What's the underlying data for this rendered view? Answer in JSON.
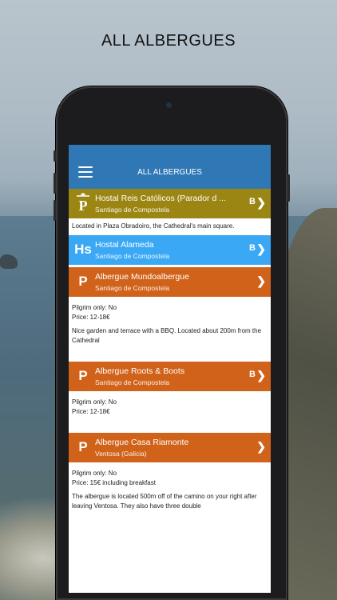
{
  "page_heading": "ALL ALBERGUES",
  "app": {
    "title": "ALL ALBERGUES",
    "menu_icon": "hamburger-menu-icon"
  },
  "items": [
    {
      "name": "Hostal Reis Católicos (Parador d ...",
      "city": "Santiago de Compostela",
      "logo": "P",
      "logo_icon": "parador-logo-icon",
      "badge": "B",
      "color": "#9c8613",
      "details": [
        "Located in Plaza Obradoiro, the Cathedral's main square."
      ]
    },
    {
      "name": "Hostal Alameda",
      "city": "Santiago de Compostela",
      "logo": "Hs",
      "badge": "B",
      "color": "#3aa8f5",
      "details": []
    },
    {
      "name": "Albergue Mundoalbergue",
      "city": "Santiago de Compostela",
      "logo": "P",
      "badge": "",
      "color": "#d0621a",
      "details": [
        "Pilgrim only: No",
        "Price: 12-18€",
        "Nice garden and terrace with a BBQ. Located about 200m from the Cathedral"
      ]
    },
    {
      "name": "Albergue Roots & Boots",
      "city": "Santiago de Compostela",
      "logo": "P",
      "badge": "B",
      "color": "#d0621a",
      "details": [
        "Pilgrim only: No",
        "Price: 12-18€"
      ]
    },
    {
      "name": "Albergue Casa Riamonte",
      "city": "Ventosa (Galicia)",
      "logo": "P",
      "badge": "",
      "color": "#d0621a",
      "details": [
        "Pilgrim only: No",
        "Price: 15€ including breakfast",
        "The albergue is located 500m off of the camino on your right after leaving Ventosa. They also have three double"
      ]
    }
  ]
}
